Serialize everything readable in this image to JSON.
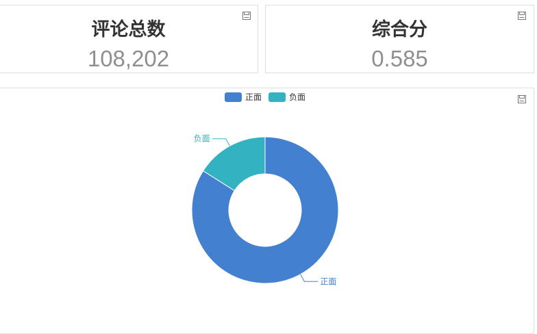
{
  "stats": [
    {
      "title": "评论总数",
      "value": "108,202"
    },
    {
      "title": "综合分",
      "value": "0.585"
    }
  ],
  "icons": {
    "save": "save-icon"
  },
  "chart_data": {
    "type": "pie",
    "variant": "donut",
    "title": "",
    "categories": [
      "正面",
      "负面"
    ],
    "values": [
      84,
      16
    ],
    "colors": [
      "#4380cf",
      "#33b3c2"
    ],
    "legend": {
      "position": "top-center",
      "entries": [
        "正面",
        "负面"
      ]
    },
    "labels_shown": true
  }
}
